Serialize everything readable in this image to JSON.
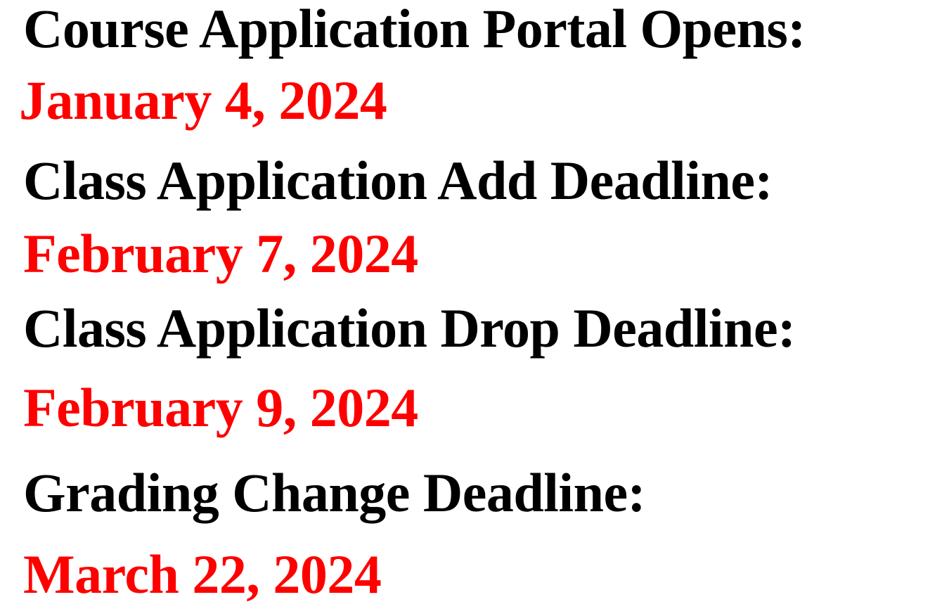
{
  "schedule": {
    "items": [
      {
        "label": "Course Application Portal Opens:",
        "date": "January 4, 2024"
      },
      {
        "label": "Class Application Add Deadline:",
        "date": "February 7, 2024"
      },
      {
        "label": "Class Application Drop Deadline:",
        "date": "February 9, 2024"
      },
      {
        "label": "Grading Change Deadline:",
        "date": "March 22, 2024"
      }
    ]
  },
  "colors": {
    "label_text": "#000000",
    "date_text": "#ff0000",
    "background": "#ffffff"
  }
}
